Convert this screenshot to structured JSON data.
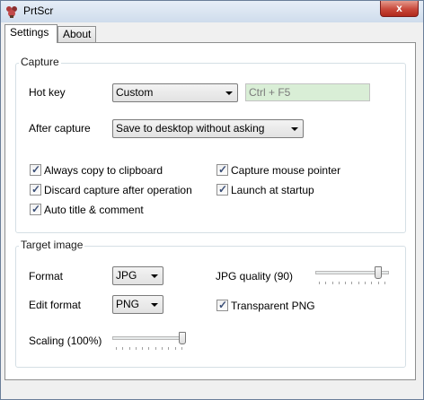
{
  "window": {
    "title": "PrtScr",
    "close_glyph": "x",
    "app_icon": "app-icon"
  },
  "tabs": [
    {
      "label": "Settings",
      "active": true
    },
    {
      "label": "About",
      "active": false
    }
  ],
  "capture": {
    "legend": "Capture",
    "hotkey_label": "Hot key",
    "hotkey_value": "Custom",
    "hotkey_combo": "Ctrl + F5",
    "after_capture_label": "After capture",
    "after_capture_value": "Save to desktop without asking",
    "options": [
      {
        "label": "Always copy to clipboard",
        "checked": true
      },
      {
        "label": "Capture mouse pointer",
        "checked": true
      },
      {
        "label": "Discard capture after operation",
        "checked": true
      },
      {
        "label": "Launch at startup",
        "checked": true
      },
      {
        "label": "Auto title & comment",
        "checked": true
      }
    ]
  },
  "target": {
    "legend": "Target image",
    "format_label": "Format",
    "format_value": "JPG",
    "edit_format_label": "Edit format",
    "edit_format_value": "PNG",
    "jpg_quality_label": "JPG quality (90)",
    "jpg_quality_value": 90,
    "transparent_png_label": "Transparent PNG",
    "transparent_png_checked": true,
    "scaling_label": "Scaling (100%)",
    "scaling_value": 100
  },
  "colors": {
    "hotkey_field_bg": "#d9eed6",
    "close_button": "#c8483a",
    "checkmark": "#3b4f77"
  }
}
